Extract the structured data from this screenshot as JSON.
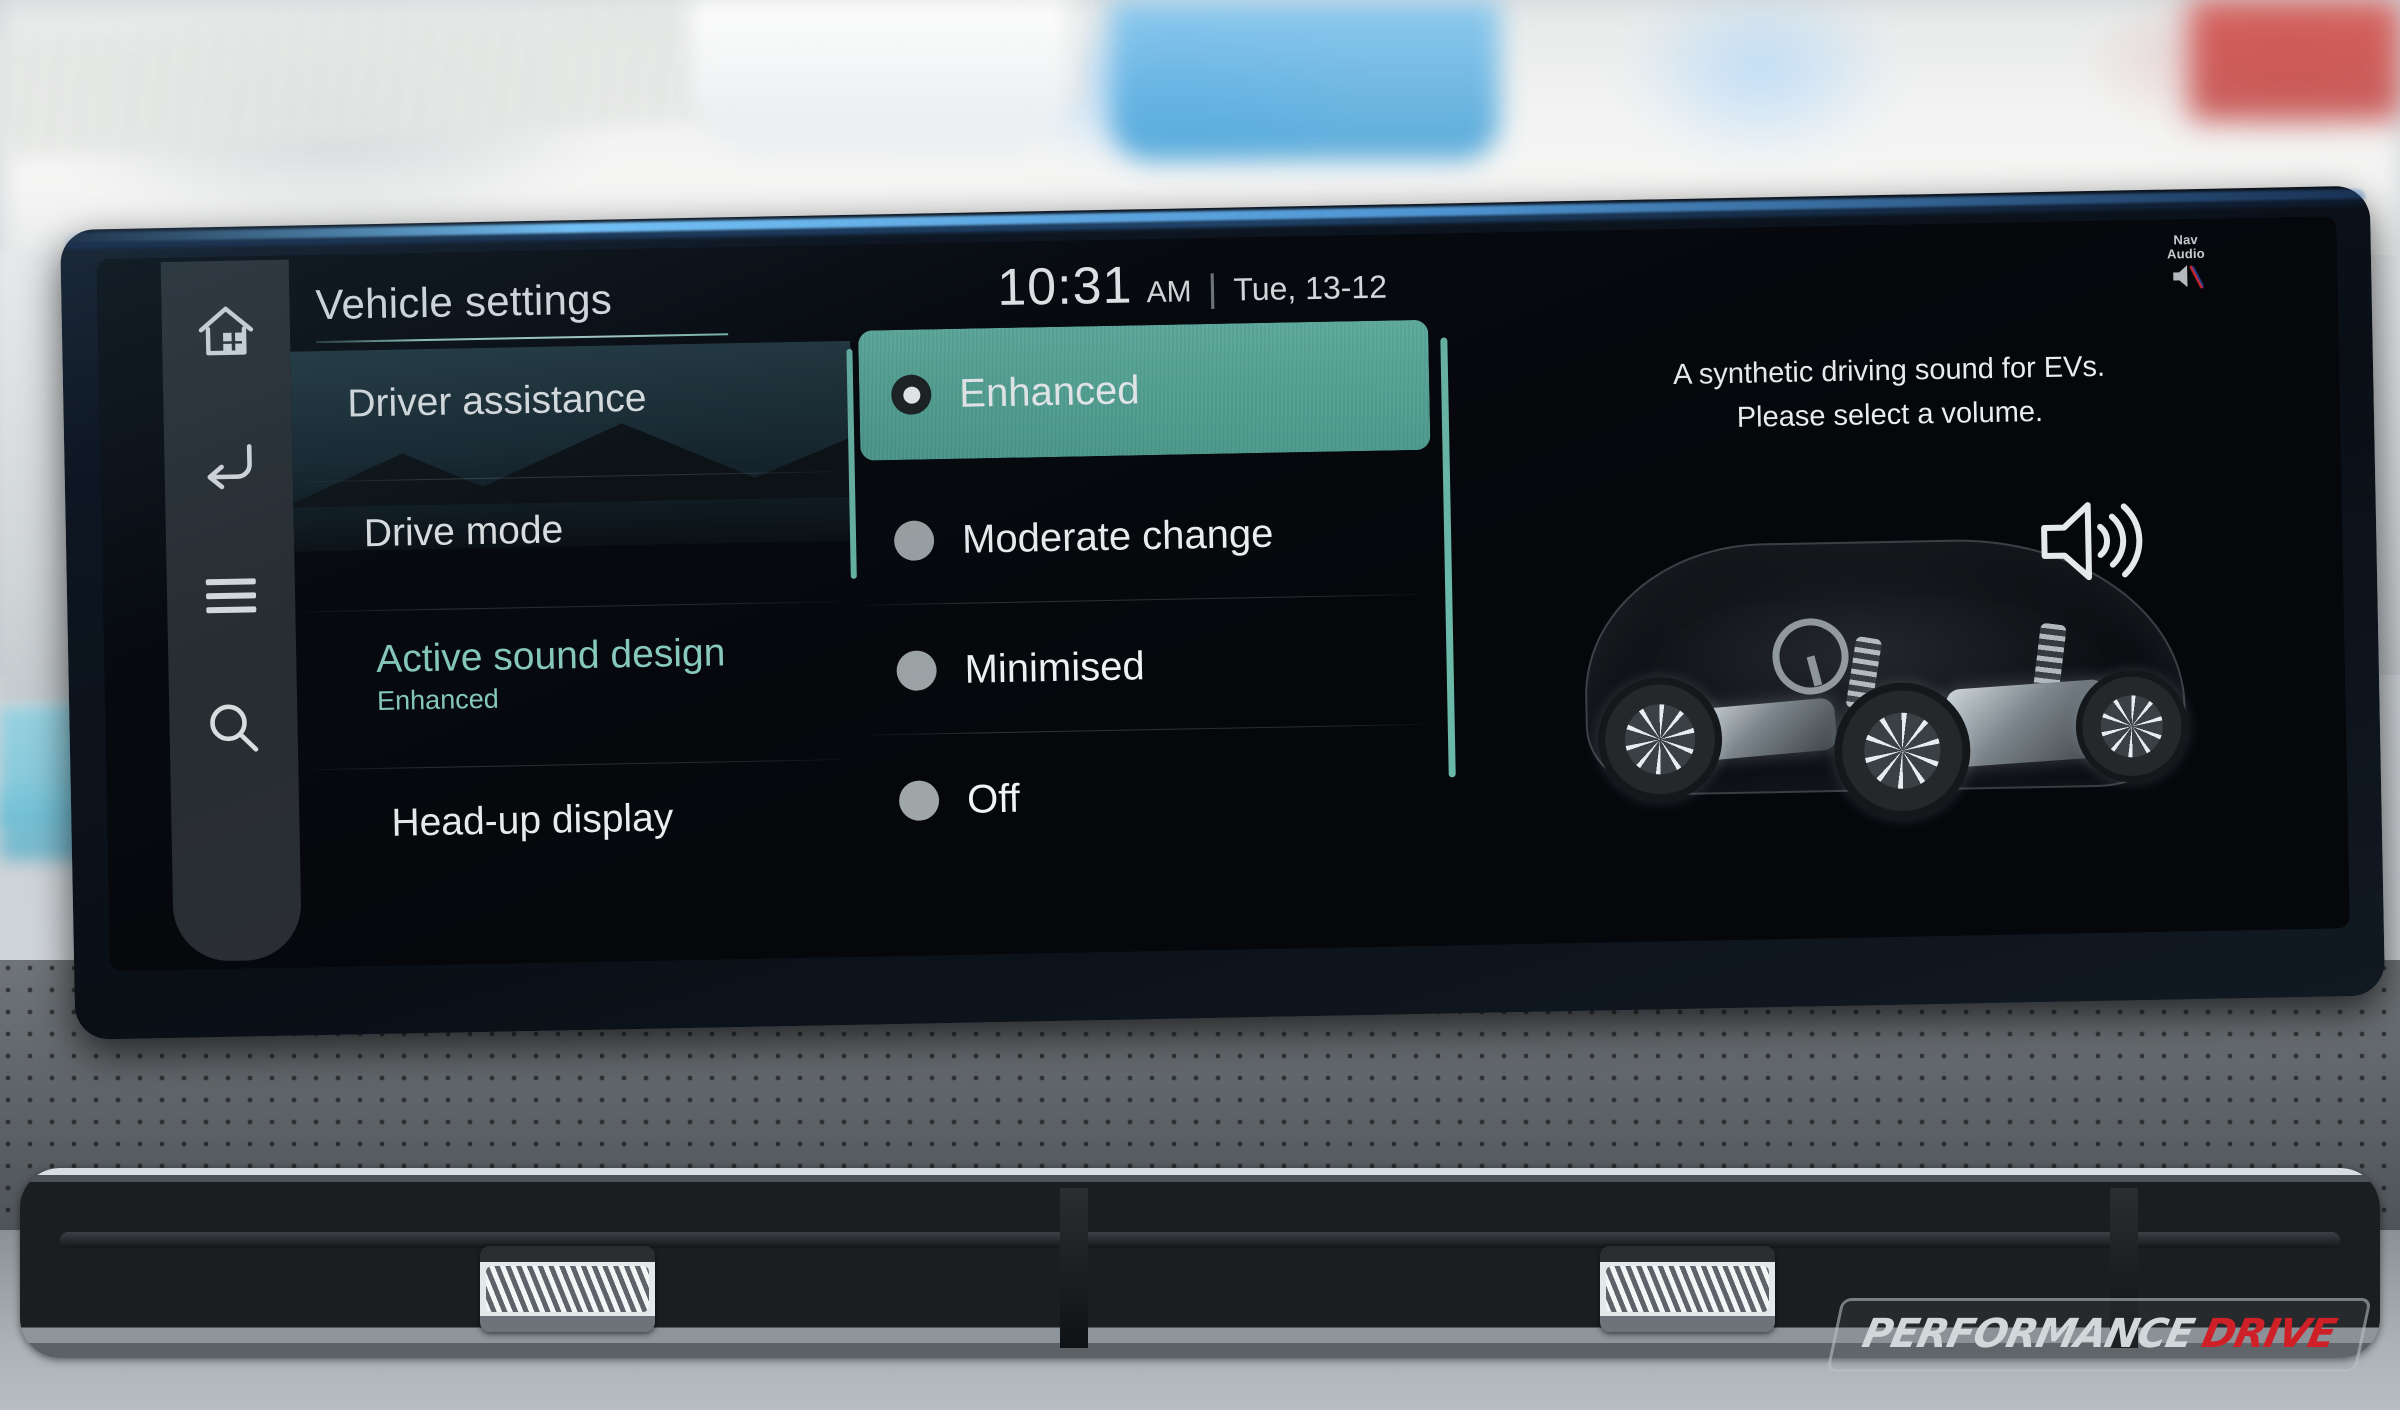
{
  "header": {
    "title": "Vehicle settings",
    "clock": {
      "time": "10:31",
      "ampm": "AM",
      "separator": "|",
      "date": "Tue, 13-12"
    },
    "nav_audio": {
      "line1": "Nav",
      "line2": "Audio",
      "icon": "speaker-muted-icon"
    }
  },
  "rail": {
    "items": [
      {
        "name": "home-icon",
        "label": "Home"
      },
      {
        "name": "back-icon",
        "label": "Back"
      },
      {
        "name": "menu-icon",
        "label": "Menu"
      },
      {
        "name": "search-icon",
        "label": "Search"
      }
    ]
  },
  "menu": {
    "items": [
      {
        "label": "Driver assistance",
        "sub": "",
        "active": false
      },
      {
        "label": "Drive mode",
        "sub": "",
        "active": false
      },
      {
        "label": "Active sound design",
        "sub": "Enhanced",
        "active": true
      },
      {
        "label": "Head-up display",
        "sub": "",
        "active": false
      }
    ]
  },
  "options": {
    "items": [
      {
        "label": "Enhanced",
        "selected": true
      },
      {
        "label": "Moderate change",
        "selected": false
      },
      {
        "label": "Minimised",
        "selected": false
      },
      {
        "label": "Off",
        "selected": false
      }
    ]
  },
  "right_panel": {
    "description_line1": "A synthetic driving sound for EVs.",
    "description_line2": "Please select a volume.",
    "illustration": "ev-chassis-illustration",
    "speaker_icon": "speaker-volume-icon"
  },
  "watermark": {
    "part1": "PERFORMANCE",
    "part2": "DRIVE"
  },
  "colors": {
    "accent_teal": "#57a899",
    "accent_teal_light": "#8ed3c6",
    "screen_bg": "#05070b",
    "text_primary": "#eef1f2",
    "radio_unselected": "#9fa6a8",
    "watermark_red": "#cf2027"
  }
}
